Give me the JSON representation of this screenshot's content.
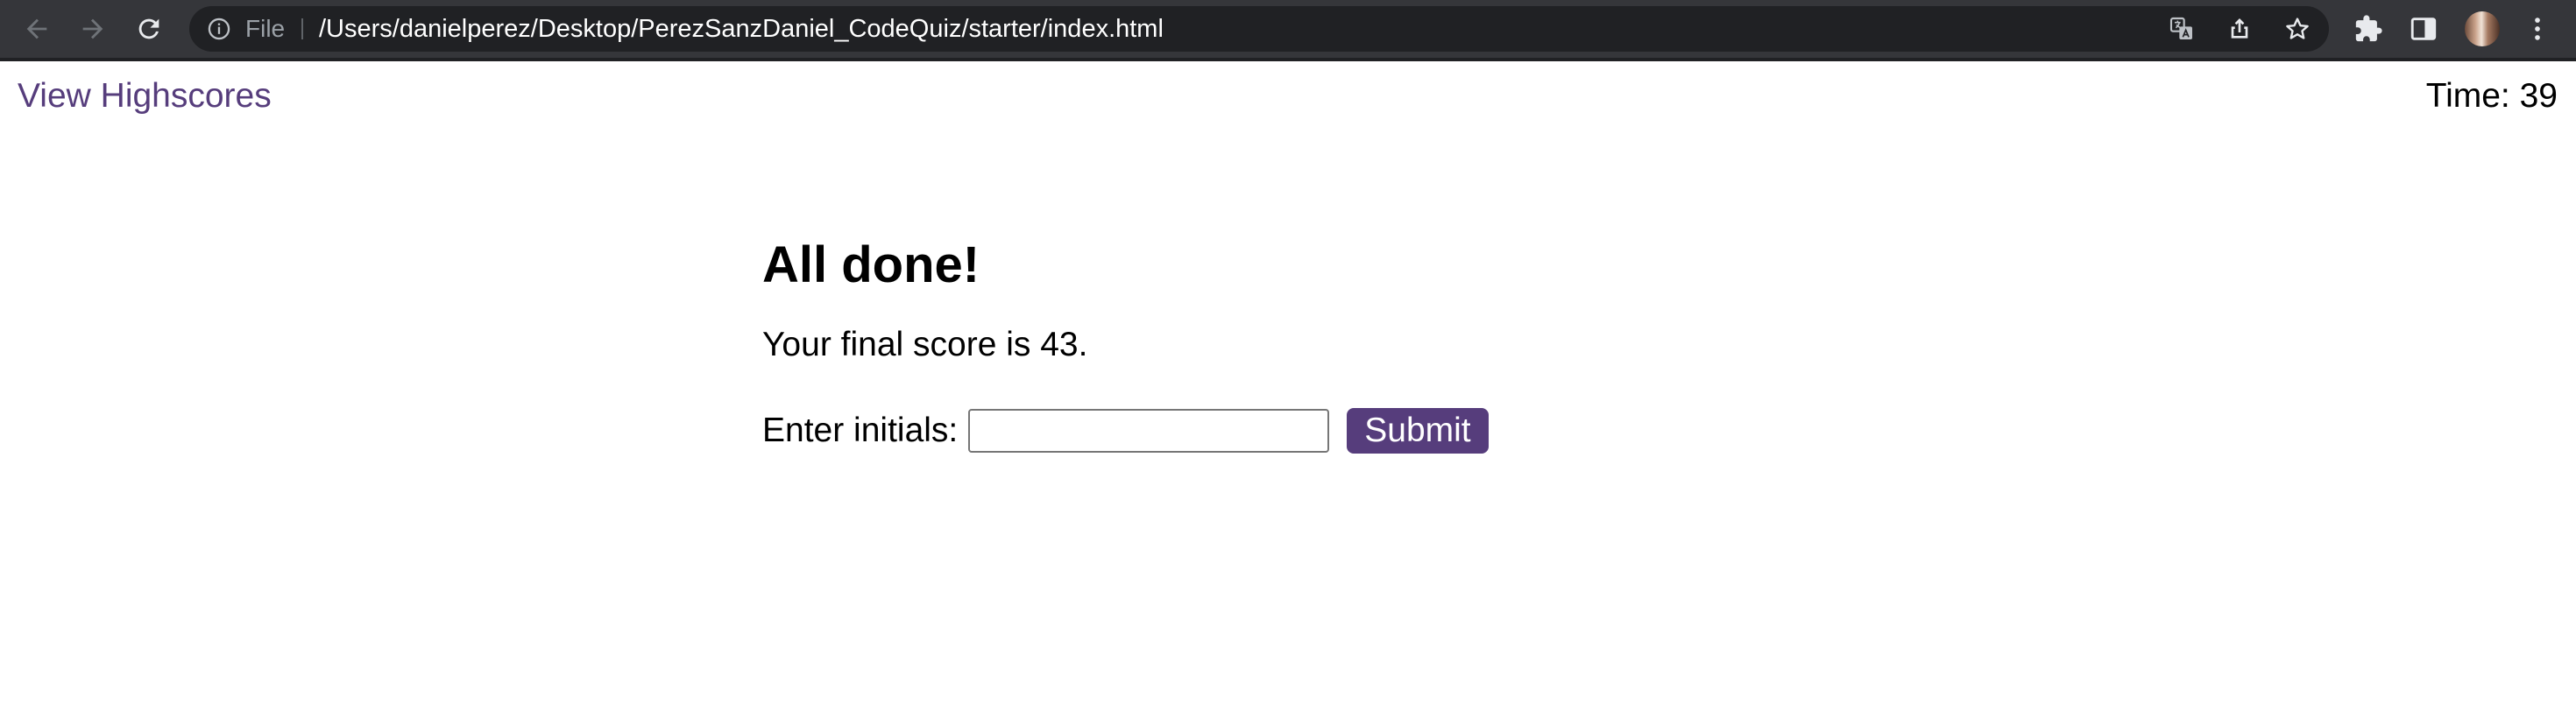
{
  "browser": {
    "address_bar": {
      "scheme_label": "File",
      "url": "/Users/danielperez/Desktop/PerezSanzDaniel_CodeQuiz/starter/index.html"
    },
    "icons": {
      "back": "arrow-left-icon",
      "forward": "arrow-right-icon",
      "reload": "reload-icon",
      "info": "info-icon",
      "translate": "translate-icon",
      "share": "share-icon",
      "bookmark": "star-icon",
      "extensions": "puzzle-icon",
      "side_panel": "side-panel-icon",
      "menu": "kebab-menu-icon"
    },
    "colors": {
      "toolbar": "#35363a",
      "omnibox": "#202124",
      "url_text": "#ffffff"
    }
  },
  "page": {
    "header": {
      "highscores_link": "View Highscores",
      "timer_label": "Time:",
      "timer_value": "39"
    },
    "end_screen": {
      "title": "All done!",
      "final_score_text": "Your final score is 43.",
      "initials_label": "Enter initials:",
      "initials_value": "",
      "submit_label": "Submit"
    },
    "colors": {
      "accent": "#563d7c",
      "text": "#000000",
      "background": "#ffffff"
    }
  }
}
